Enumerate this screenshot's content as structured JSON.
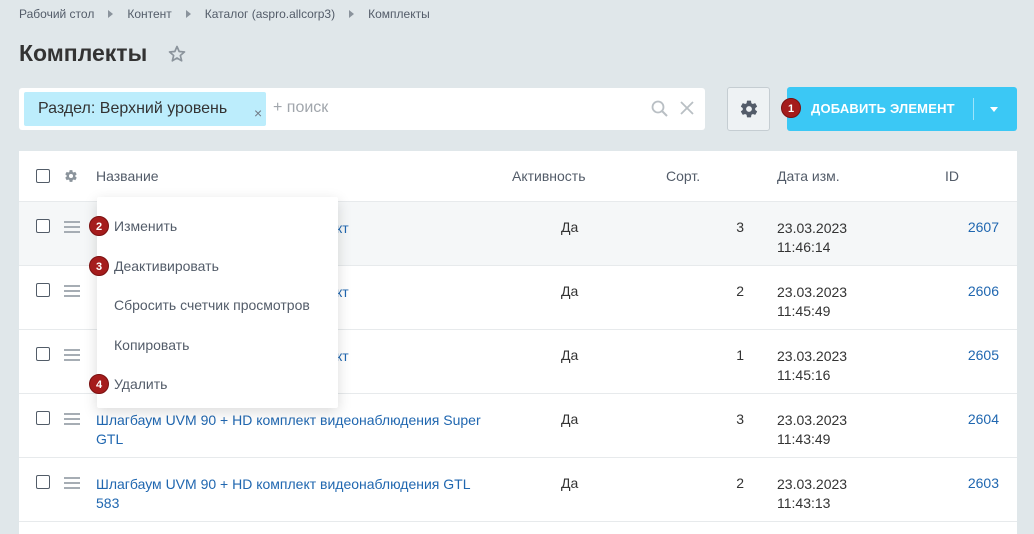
{
  "breadcrumb": [
    "Рабочий стол",
    "Контент",
    "Каталог (aspro.allcorp3)",
    "Комплекты"
  ],
  "page_title": "Комплекты",
  "filter": {
    "tag_label": "Раздел: Верхний уровень",
    "tag_close": "×",
    "search_placeholder": "+ поиск"
  },
  "add_button": {
    "label": "ДОБАВИТЬ ЭЛЕМЕНТ"
  },
  "badges": [
    "1",
    "2",
    "3",
    "4"
  ],
  "columns": {
    "name": "Название",
    "active": "Активность",
    "sort": "Сорт.",
    "date": "Дата изм.",
    "id": "ID"
  },
  "rows": [
    {
      "name": "кт",
      "active": "Да",
      "sort": "3",
      "date": "23.03.2023",
      "time": "11:46:14",
      "id": "2607"
    },
    {
      "name": "кт",
      "active": "Да",
      "sort": "2",
      "date": "23.03.2023",
      "time": "11:45:49",
      "id": "2606"
    },
    {
      "name": "кт",
      "active": "Да",
      "sort": "1",
      "date": "23.03.2023",
      "time": "11:45:16",
      "id": "2605"
    },
    {
      "name": "Шлагбаум UVM 90 + HD комплект видеонаблюдения Super GTL",
      "active": "Да",
      "sort": "3",
      "date": "23.03.2023",
      "time": "11:43:49",
      "id": "2604"
    },
    {
      "name": "Шлагбаум UVM 90 + HD комплект видеонаблюдения GTL 583",
      "active": "Да",
      "sort": "2",
      "date": "23.03.2023",
      "time": "11:43:13",
      "id": "2603"
    }
  ],
  "context_menu": [
    "Изменить",
    "Деактивировать",
    "Сбросить счетчик просмотров",
    "Копировать",
    "Удалить"
  ],
  "colors": {
    "accent": "#3bc8f5",
    "link": "#2067b0",
    "badge": "#a51c1c",
    "filter_tag": "#bcedfc",
    "background": "#e0e7ea"
  }
}
